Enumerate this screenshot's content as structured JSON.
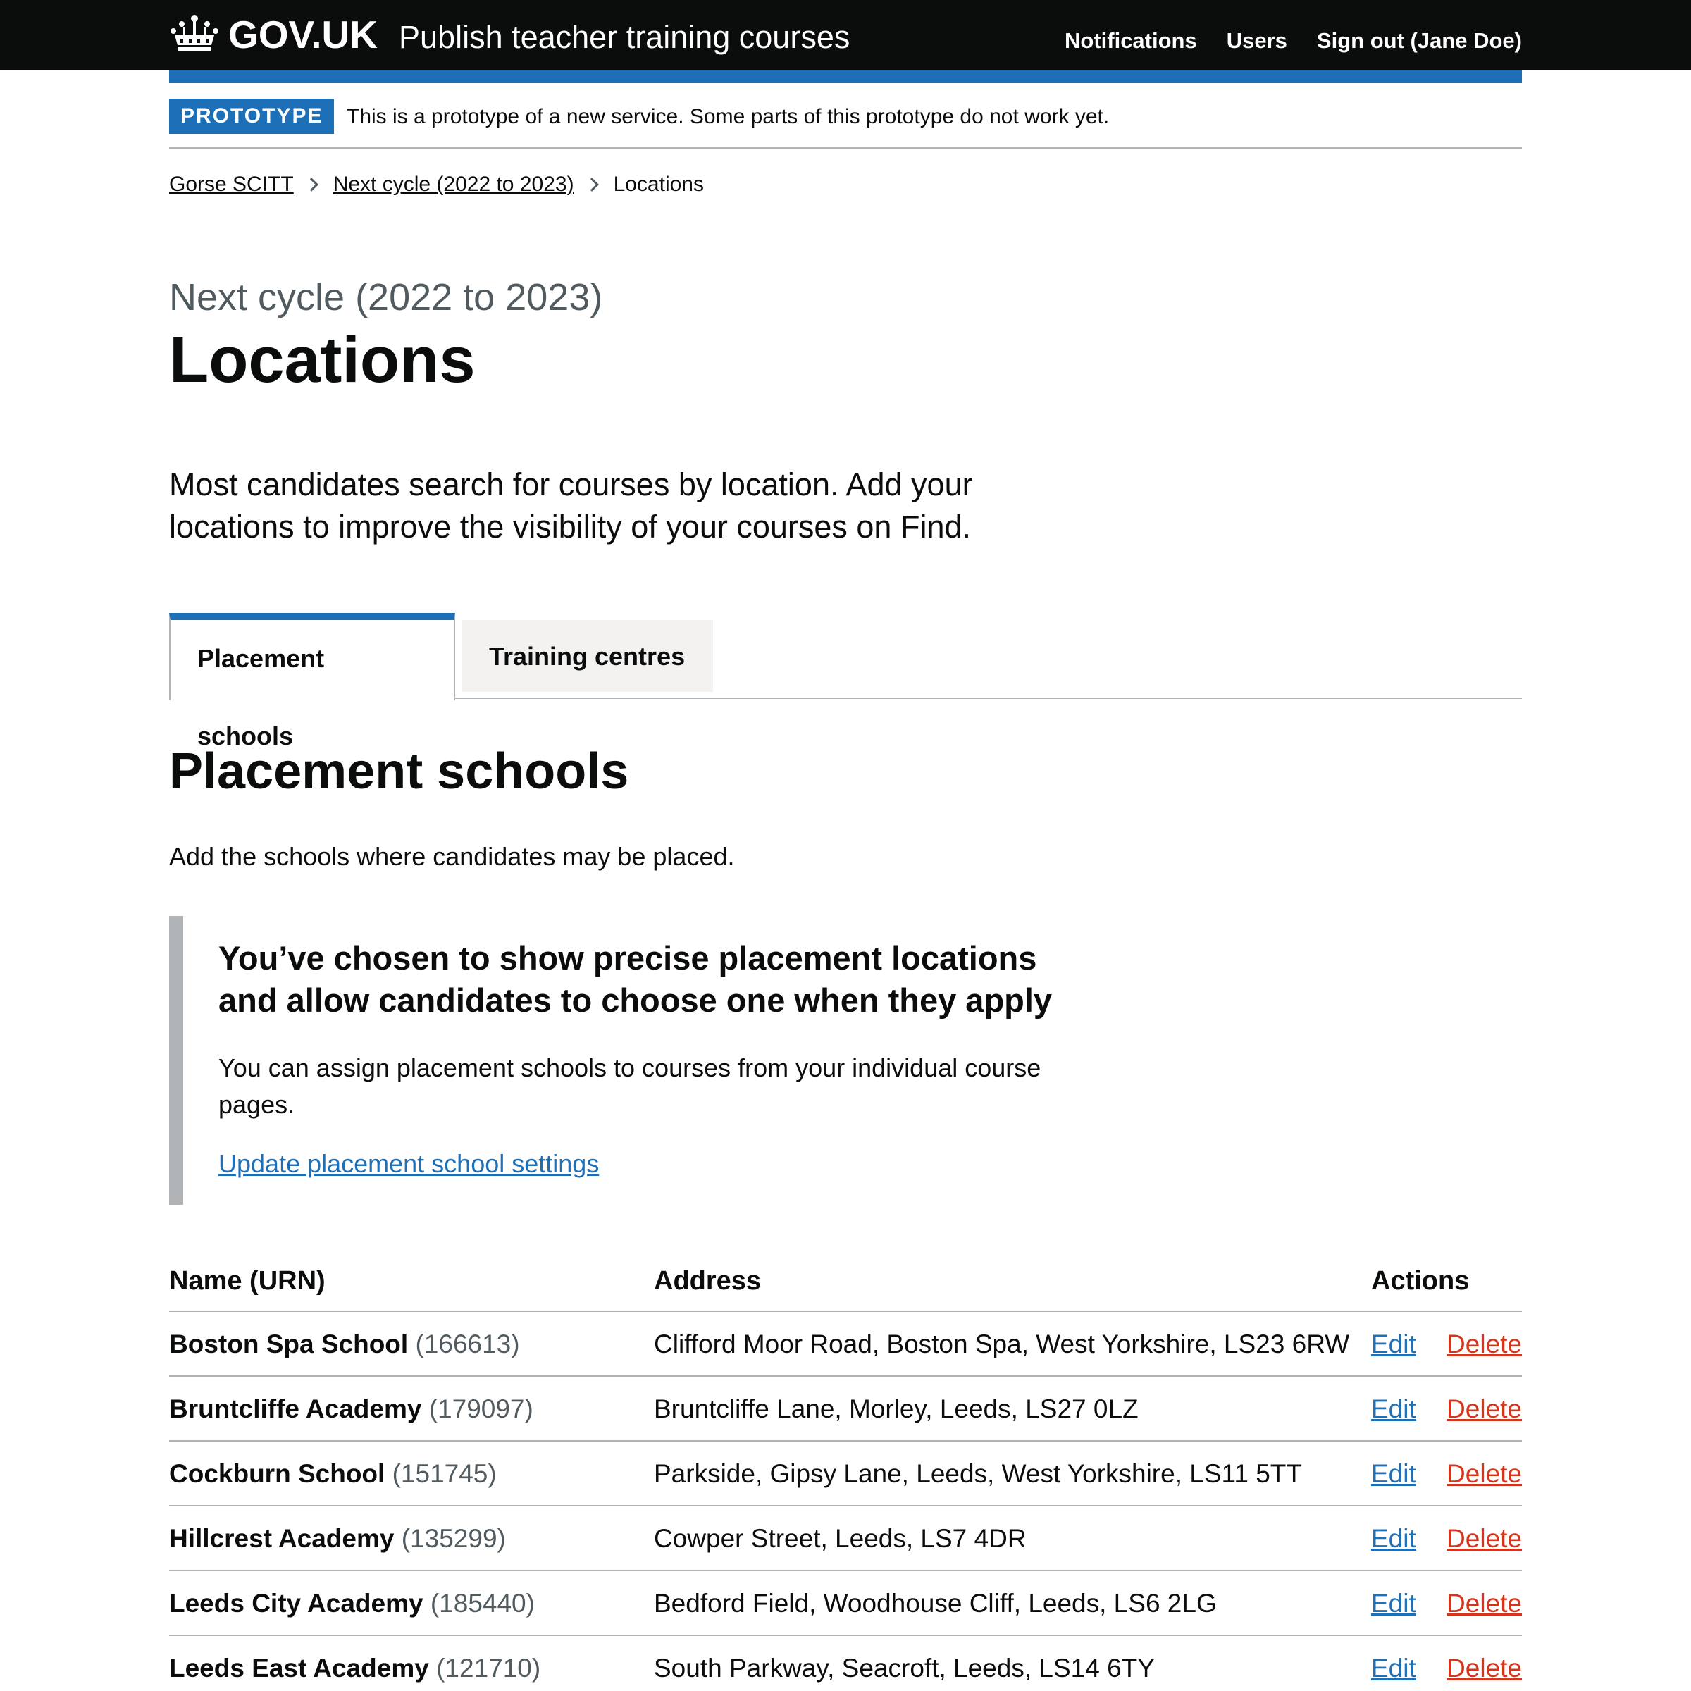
{
  "header": {
    "logo_text": "GOV.UK",
    "service_name": "Publish teacher training courses",
    "nav": [
      "Notifications",
      "Users",
      "Sign out (Jane Doe)"
    ]
  },
  "phase_banner": {
    "tag": "PROTOTYPE",
    "text": "This is a prototype of a new service. Some parts of this prototype do not work yet."
  },
  "breadcrumbs": {
    "items": [
      "Gorse SCITT",
      "Next cycle (2022 to 2023)"
    ],
    "current": "Locations"
  },
  "page": {
    "caption": "Next cycle (2022 to 2023)",
    "title": "Locations",
    "lead": "Most candidates search for courses by location. Add your locations to improve the visibility of your courses on Find."
  },
  "tabs": [
    "Placement schools",
    "Training centres"
  ],
  "section": {
    "heading": "Placement schools",
    "description": "Add the schools where candidates may be placed."
  },
  "inset": {
    "heading": "You’ve chosen to show precise placement locations and allow candidates to choose one when they apply",
    "body": "You can assign placement schools to courses from your individual course pages.",
    "link": "Update placement school settings"
  },
  "table": {
    "headers": [
      "Name (URN)",
      "Address",
      "Actions"
    ],
    "edit_label": "Edit",
    "delete_label": "Delete",
    "rows": [
      {
        "name": "Boston Spa School",
        "urn": "(166613)",
        "address": "Clifford Moor Road, Boston Spa, West Yorkshire, LS23 6RW"
      },
      {
        "name": "Bruntcliffe Academy",
        "urn": "(179097)",
        "address": "Bruntcliffe Lane, Morley, Leeds, LS27 0LZ"
      },
      {
        "name": "Cockburn School",
        "urn": "(151745)",
        "address": "Parkside, Gipsy Lane, Leeds, West Yorkshire, LS11 5TT"
      },
      {
        "name": "Hillcrest Academy",
        "urn": "(135299)",
        "address": "Cowper Street, Leeds, LS7 4DR"
      },
      {
        "name": "Leeds City Academy",
        "urn": "(185440)",
        "address": "Bedford Field, Woodhouse Cliff, Leeds, LS6 2LG"
      },
      {
        "name": "Leeds East Academy",
        "urn": "(121710)",
        "address": "South Parkway, Seacroft, Leeds, LS14 6TY"
      }
    ]
  },
  "colors": {
    "header_bg": "#0b0c0c",
    "brand_blue": "#1d70b8",
    "link": "#1d70b8",
    "danger": "#d4351c",
    "secondary_text": "#505a5f",
    "border": "#b1b4b6"
  },
  "icons": {
    "logo": "crown-icon",
    "breadcrumb_separator": "chevron-right-icon"
  }
}
